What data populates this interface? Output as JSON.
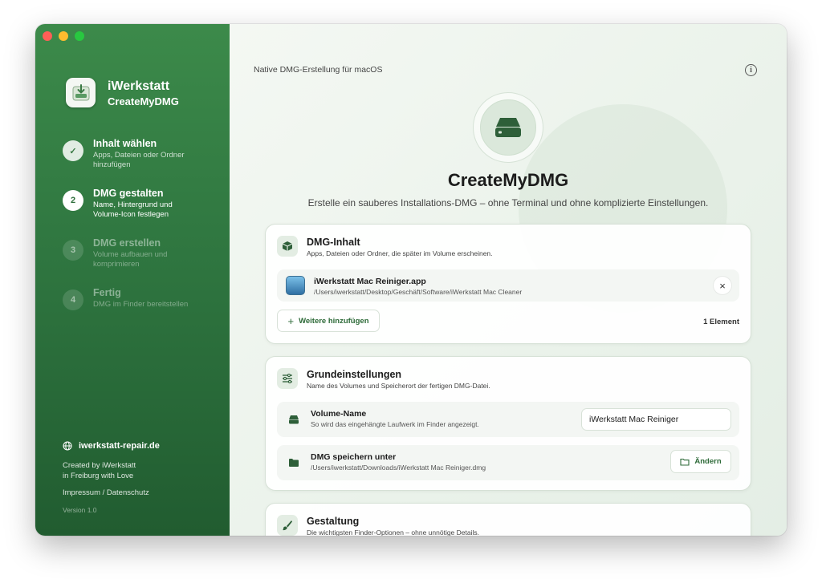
{
  "sidebar": {
    "app_name": "iWerkstatt",
    "app_product": "CreateMyDMG",
    "steps": [
      {
        "number": "✓",
        "title": "Inhalt wählen",
        "desc": "Apps, Dateien oder Ordner hinzufügen",
        "state": "done"
      },
      {
        "number": "2",
        "title": "DMG gestalten",
        "desc": "Name, Hintergrund und Volume-Icon festlegen",
        "state": "active"
      },
      {
        "number": "3",
        "title": "DMG erstellen",
        "desc": "Volume aufbauen und komprimieren",
        "state": "todo"
      },
      {
        "number": "4",
        "title": "Fertig",
        "desc": "DMG im Finder bereitstellen",
        "state": "todo"
      }
    ],
    "website": "iwerkstatt-repair.de",
    "credit_line1": "Created by iWerkstatt",
    "credit_line2": "in Freiburg with Love",
    "legal": "Impressum / Datenschutz",
    "version": "Version 1.0"
  },
  "main": {
    "topline": "Native DMG-Erstellung für macOS",
    "info_glyph": "i",
    "hero_title": "CreateMyDMG",
    "hero_subtitle": "Erstelle ein sauberes Installations-DMG – ohne Terminal und ohne komplizierte Einstellungen."
  },
  "content_card": {
    "title": "DMG-Inhalt",
    "subtitle": "Apps, Dateien oder Ordner, die später im Volume erscheinen.",
    "file": {
      "name": "iWerkstatt Mac Reiniger.app",
      "path": "/Users/iwerkstatt/Desktop/Geschäft/Software/iWerkstatt Mac Cleaner"
    },
    "remove_glyph": "×",
    "add_label": "Weitere hinzufügen",
    "count_label": "1 Element"
  },
  "settings_card": {
    "title": "Grundeinstellungen",
    "subtitle": "Name des Volumes und Speicherort der fertigen DMG-Datei.",
    "volume_label": "Volume-Name",
    "volume_sub": "So wird das eingehängte Laufwerk im Finder angezeigt.",
    "volume_value": "iWerkstatt Mac Reiniger",
    "save_label": "DMG speichern unter",
    "save_path": "/Users/iwerkstatt/Downloads/iWerkstatt Mac Reiniger.dmg",
    "change_label": "Ändern"
  },
  "design_card": {
    "title": "Gestaltung",
    "subtitle": "Die wichtigsten Finder-Optionen – ohne unnötige Details."
  },
  "colors": {
    "accent": "#2f7640",
    "sidebar_top": "#3c8a4a",
    "sidebar_bottom": "#215c30"
  }
}
